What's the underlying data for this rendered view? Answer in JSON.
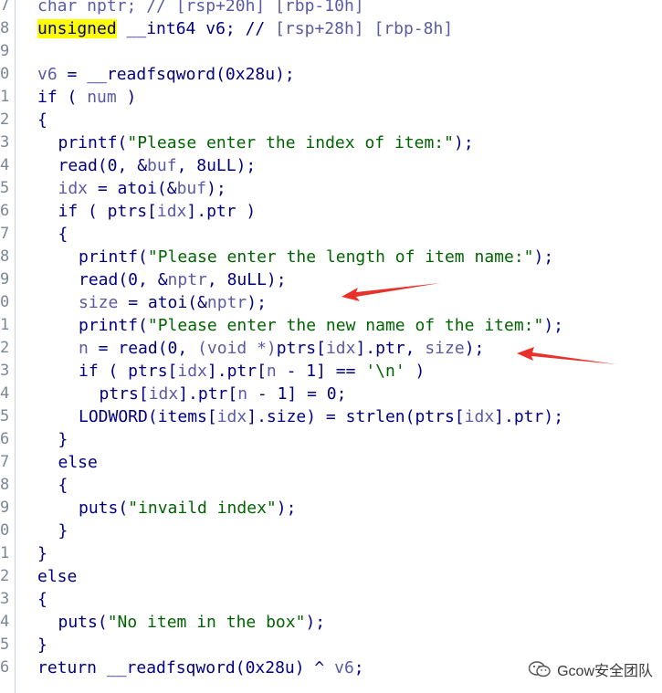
{
  "gutter": [
    "7",
    "8",
    "9",
    "0",
    "1",
    "2",
    "3",
    "4",
    "5",
    "6",
    "7",
    "8",
    "9",
    "0",
    "1",
    "2",
    "3",
    "4",
    "5",
    "6",
    "7",
    "8",
    "9",
    "0",
    "1",
    "2",
    "3",
    "4",
    "5",
    "6"
  ],
  "lines": [
    {
      "indent": 0,
      "segs": [
        {
          "t": "char nptr; // [rsp+20h] [rbp-10h]",
          "c": "faded"
        }
      ]
    },
    {
      "indent": 0,
      "segs": [
        {
          "t": "unsigned",
          "c": "hl"
        },
        {
          "t": " __int64 v6; // ",
          "c": "code"
        },
        {
          "t": "[rsp+28h] [rbp-8h]",
          "c": "var"
        }
      ]
    },
    {
      "indent": 0,
      "segs": []
    },
    {
      "indent": 0,
      "segs": [
        {
          "t": "v6",
          "c": "var"
        },
        {
          "t": " = __readfsqword(0x28u);",
          "c": "code"
        }
      ]
    },
    {
      "indent": 0,
      "segs": [
        {
          "t": "if ( ",
          "c": "code"
        },
        {
          "t": "num",
          "c": "var"
        },
        {
          "t": " )",
          "c": "code"
        }
      ]
    },
    {
      "indent": 0,
      "segs": [
        {
          "t": "{",
          "c": "code"
        }
      ]
    },
    {
      "indent": 1,
      "segs": [
        {
          "t": "printf(",
          "c": "code"
        },
        {
          "t": "\"Please enter the index of item:\"",
          "c": "str"
        },
        {
          "t": ");",
          "c": "code"
        }
      ]
    },
    {
      "indent": 1,
      "segs": [
        {
          "t": "read(0, &",
          "c": "code"
        },
        {
          "t": "buf",
          "c": "var"
        },
        {
          "t": ", 8uLL);",
          "c": "code"
        }
      ]
    },
    {
      "indent": 1,
      "segs": [
        {
          "t": "idx",
          "c": "var"
        },
        {
          "t": " = atoi(&",
          "c": "code"
        },
        {
          "t": "buf",
          "c": "var"
        },
        {
          "t": ");",
          "c": "code"
        }
      ]
    },
    {
      "indent": 1,
      "segs": [
        {
          "t": "if ( ptrs[",
          "c": "code"
        },
        {
          "t": "idx",
          "c": "var"
        },
        {
          "t": "].ptr )",
          "c": "code"
        }
      ]
    },
    {
      "indent": 1,
      "segs": [
        {
          "t": "{",
          "c": "code"
        }
      ]
    },
    {
      "indent": 2,
      "segs": [
        {
          "t": "printf(",
          "c": "code"
        },
        {
          "t": "\"Please enter the length of item name:\"",
          "c": "str"
        },
        {
          "t": ");",
          "c": "code"
        }
      ]
    },
    {
      "indent": 2,
      "segs": [
        {
          "t": "read(0, &",
          "c": "code"
        },
        {
          "t": "nptr",
          "c": "var"
        },
        {
          "t": ", 8uLL);",
          "c": "code"
        }
      ]
    },
    {
      "indent": 2,
      "segs": [
        {
          "t": "size",
          "c": "var"
        },
        {
          "t": " = atoi(&",
          "c": "code"
        },
        {
          "t": "nptr",
          "c": "var"
        },
        {
          "t": ");",
          "c": "code"
        }
      ]
    },
    {
      "indent": 2,
      "segs": [
        {
          "t": "printf(",
          "c": "code"
        },
        {
          "t": "\"Please enter the new name of the item:\"",
          "c": "str"
        },
        {
          "t": ");",
          "c": "code"
        }
      ]
    },
    {
      "indent": 2,
      "segs": [
        {
          "t": "n",
          "c": "var"
        },
        {
          "t": " = read(0, ",
          "c": "code"
        },
        {
          "t": "(void *)",
          "c": "var"
        },
        {
          "t": "ptrs[",
          "c": "code"
        },
        {
          "t": "idx",
          "c": "var"
        },
        {
          "t": "].ptr, ",
          "c": "code"
        },
        {
          "t": "size",
          "c": "var"
        },
        {
          "t": ");",
          "c": "code"
        }
      ]
    },
    {
      "indent": 2,
      "segs": [
        {
          "t": "if ( ptrs[",
          "c": "code"
        },
        {
          "t": "idx",
          "c": "var"
        },
        {
          "t": "].ptr[",
          "c": "code"
        },
        {
          "t": "n",
          "c": "var"
        },
        {
          "t": " - 1] == ",
          "c": "code"
        },
        {
          "t": "'\\n'",
          "c": "str"
        },
        {
          "t": " )",
          "c": "code"
        }
      ]
    },
    {
      "indent": 3,
      "segs": [
        {
          "t": "ptrs[",
          "c": "code"
        },
        {
          "t": "idx",
          "c": "var"
        },
        {
          "t": "].ptr[",
          "c": "code"
        },
        {
          "t": "n",
          "c": "var"
        },
        {
          "t": " - 1] = 0;",
          "c": "code"
        }
      ]
    },
    {
      "indent": 2,
      "segs": [
        {
          "t": "LODWORD(items[",
          "c": "code"
        },
        {
          "t": "idx",
          "c": "var"
        },
        {
          "t": "].size) = strlen(ptrs[",
          "c": "code"
        },
        {
          "t": "idx",
          "c": "var"
        },
        {
          "t": "].ptr);",
          "c": "code"
        }
      ]
    },
    {
      "indent": 1,
      "segs": [
        {
          "t": "}",
          "c": "code"
        }
      ]
    },
    {
      "indent": 1,
      "segs": [
        {
          "t": "else",
          "c": "code"
        }
      ]
    },
    {
      "indent": 1,
      "segs": [
        {
          "t": "{",
          "c": "code"
        }
      ]
    },
    {
      "indent": 2,
      "segs": [
        {
          "t": "puts(",
          "c": "code"
        },
        {
          "t": "\"invaild index\"",
          "c": "str"
        },
        {
          "t": ");",
          "c": "code"
        }
      ]
    },
    {
      "indent": 1,
      "segs": [
        {
          "t": "}",
          "c": "code"
        }
      ]
    },
    {
      "indent": 0,
      "segs": [
        {
          "t": "}",
          "c": "code"
        }
      ]
    },
    {
      "indent": 0,
      "segs": [
        {
          "t": "else",
          "c": "code"
        }
      ]
    },
    {
      "indent": 0,
      "segs": [
        {
          "t": "{",
          "c": "code"
        }
      ]
    },
    {
      "indent": 1,
      "segs": [
        {
          "t": "puts(",
          "c": "code"
        },
        {
          "t": "\"No item in the box\"",
          "c": "str"
        },
        {
          "t": ");",
          "c": "code"
        }
      ]
    },
    {
      "indent": 0,
      "segs": [
        {
          "t": "}",
          "c": "code"
        }
      ]
    },
    {
      "indent": 0,
      "segs": [
        {
          "t": "return __readfsqword(0x28u) ^ ",
          "c": "code"
        },
        {
          "t": "v6",
          "c": "var"
        },
        {
          "t": ";",
          "c": "code"
        }
      ]
    }
  ],
  "annotations": {
    "arrow_color": "#e8312a",
    "arrow_icons": [
      "arrow-left-icon",
      "arrow-left-icon"
    ]
  },
  "watermark": {
    "text": "Gcow安全团队",
    "icon": "wechat-icon"
  }
}
